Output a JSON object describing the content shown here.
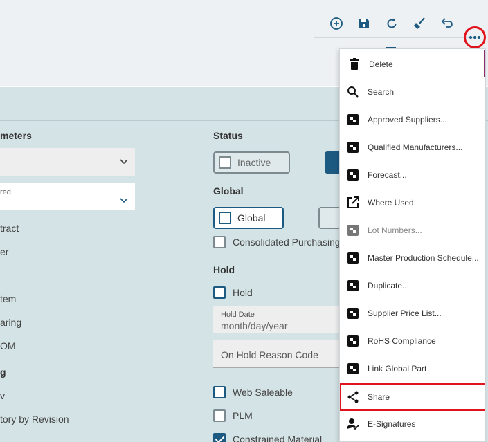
{
  "toolbar": {
    "buttons": [
      {
        "name": "add-icon"
      },
      {
        "name": "save-icon"
      },
      {
        "name": "refresh-icon"
      },
      {
        "name": "clear-icon"
      },
      {
        "name": "undo-icon"
      }
    ],
    "more_icon": "more-icon",
    "accent": "#1d5a82",
    "highlight": "#e0141e"
  },
  "left_panel": {
    "title": "meters",
    "select_label": "red",
    "items": [
      "tract",
      "er",
      "tem",
      "aring",
      "OM"
    ],
    "subtitle": "g",
    "items2": [
      "v",
      "tory by Revision"
    ]
  },
  "status": {
    "title": "Status",
    "inactive_label": "Inactive"
  },
  "global": {
    "title": "Global",
    "global_label": "Global",
    "consolidated_label": "Consolidated Purchasing"
  },
  "hold": {
    "title": "Hold",
    "hold_label": "Hold",
    "hold_date_label": "Hold Date",
    "hold_date_value": "month/day/year",
    "reason_placeholder": "On Hold Reason Code"
  },
  "checks": {
    "web_saleable": "Web Saleable",
    "plm": "PLM",
    "constrained": "Constrained Material"
  },
  "menu": {
    "items": [
      {
        "label": "Delete",
        "icon": "trash-icon",
        "state": "focused"
      },
      {
        "label": "Search",
        "icon": "search-icon",
        "state": ""
      },
      {
        "label": "Approved Suppliers...",
        "icon": "form-icon",
        "state": ""
      },
      {
        "label": "Qualified Manufacturers...",
        "icon": "form-icon",
        "state": ""
      },
      {
        "label": "Forecast...",
        "icon": "form-icon",
        "state": ""
      },
      {
        "label": "Where Used",
        "icon": "external-link-icon",
        "state": ""
      },
      {
        "label": "Lot Numbers...",
        "icon": "form-icon",
        "state": "disabled"
      },
      {
        "label": "Master Production Schedule...",
        "icon": "form-icon",
        "state": ""
      },
      {
        "label": "Duplicate...",
        "icon": "form-icon",
        "state": ""
      },
      {
        "label": "Supplier Price List...",
        "icon": "form-icon",
        "state": ""
      },
      {
        "label": "RoHS Compliance",
        "icon": "form-icon",
        "state": ""
      },
      {
        "label": "Link Global Part",
        "icon": "form-icon",
        "state": ""
      },
      {
        "label": "Share",
        "icon": "share-icon",
        "state": "highlighted"
      },
      {
        "label": "E-Signatures",
        "icon": "user-check-icon",
        "state": ""
      }
    ]
  }
}
